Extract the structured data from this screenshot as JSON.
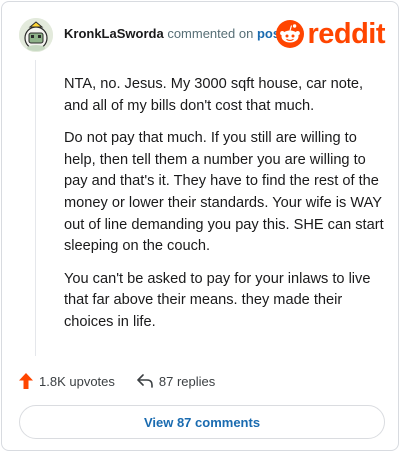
{
  "header": {
    "username": "KronkLaSworda",
    "action_text": "commented on",
    "post_link": "post",
    "brand": "reddit"
  },
  "comment": {
    "paragraphs": [
      "NTA, no. Jesus. My 3000 sqft house, car note, and all of my bills don't cost that much.",
      "Do not pay that much. If you still are willing to help, then tell them a number you are willing to pay and that's it. They have to find the rest of the money or lower their standards. Your wife is WAY out of line demanding you pay this. SHE can start sleeping on the couch.",
      "You can't be asked to pay for your inlaws to live that far above their means. they made their choices in life."
    ]
  },
  "actions": {
    "upvotes": "1.8K upvotes",
    "replies": "87 replies"
  },
  "footer": {
    "view_comments": "View 87 comments"
  },
  "colors": {
    "brand": "#ff4500",
    "link": "#1a6bb0",
    "upvote": "#ff4500"
  },
  "icons": [
    "avatar",
    "reddit-snoo-icon",
    "upvote-arrow-icon",
    "reply-arrow-icon"
  ]
}
